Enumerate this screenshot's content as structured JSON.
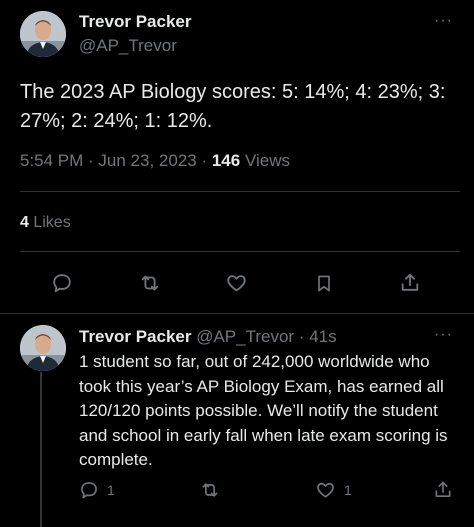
{
  "tweet": {
    "author_name": "Trevor Packer",
    "author_handle": "@AP_Trevor",
    "more_label": "···",
    "text": "The 2023 AP Biology scores: 5: 14%; 4: 23%; 3: 27%; 2: 24%; 1: 12%.",
    "time": "5:54 PM",
    "separator": " · ",
    "date": "Jun 23, 2023",
    "views_count": "146",
    "views_label": " Views",
    "likes_count": "4",
    "likes_label": " Likes",
    "actions": [
      {
        "name": "reply",
        "icon": "comment-icon"
      },
      {
        "name": "retweet",
        "icon": "retweet-icon"
      },
      {
        "name": "like",
        "icon": "heart-icon"
      },
      {
        "name": "bookmark",
        "icon": "bookmark-icon"
      },
      {
        "name": "share",
        "icon": "share-icon"
      }
    ]
  },
  "reply": {
    "author_name": "Trevor Packer",
    "author_handle": "@AP_Trevor",
    "separator": " · ",
    "time": "41s",
    "more_label": "···",
    "text": "1 student so far, out of 242,000 worldwide who took this year’s AP Biology Exam, has earned all 120/120 points possible. We’ll notify the student and school in early fall when late exam scoring is complete.",
    "reply_count": "1",
    "like_count": "1"
  },
  "colors": {
    "background": "#000000",
    "text": "#e7e9ea",
    "muted": "#71767b",
    "border": "#2f3336"
  }
}
